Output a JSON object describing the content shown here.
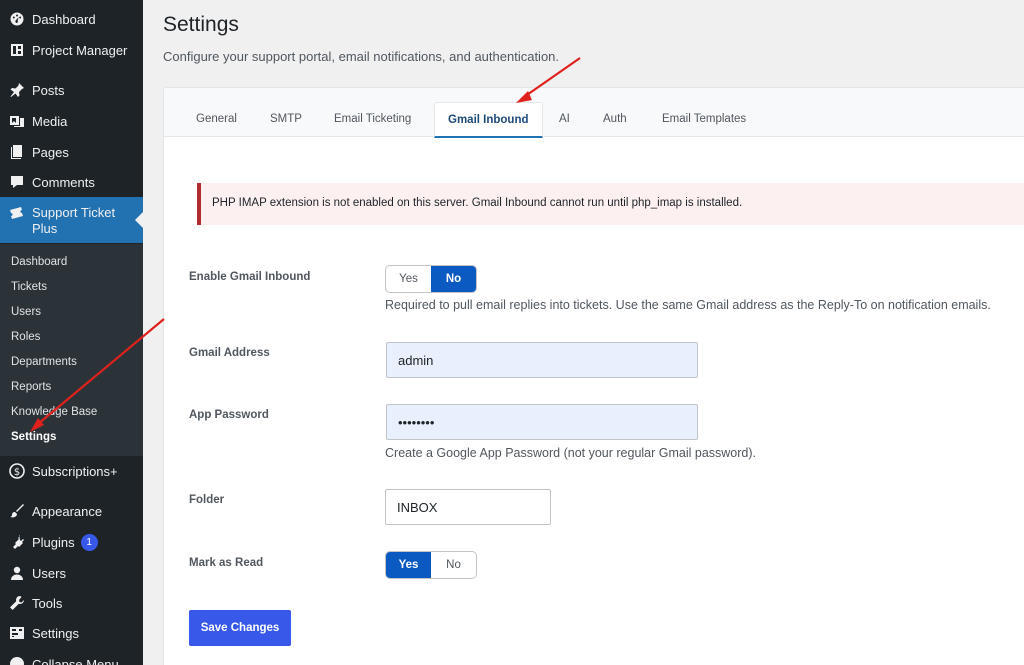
{
  "sidebar": {
    "items": [
      {
        "label": "Dashboard",
        "icon": "dashboard-icon"
      },
      {
        "label": "Project Manager",
        "icon": "project-icon"
      },
      {
        "label": "Posts",
        "icon": "pin-icon"
      },
      {
        "label": "Media",
        "icon": "media-icon"
      },
      {
        "label": "Pages",
        "icon": "pages-icon"
      },
      {
        "label": "Comments",
        "icon": "comment-icon"
      },
      {
        "label": "Support Ticket Plus",
        "icon": "ticket-icon"
      },
      {
        "label": "Subscriptions+",
        "icon": "dollar-icon"
      },
      {
        "label": "Appearance",
        "icon": "brush-icon"
      },
      {
        "label": "Plugins",
        "icon": "plug-icon",
        "badge": "1"
      },
      {
        "label": "Users",
        "icon": "user-icon"
      },
      {
        "label": "Tools",
        "icon": "wrench-icon"
      },
      {
        "label": "Settings",
        "icon": "settings-icon"
      },
      {
        "label": "Collapse Menu",
        "icon": "collapse-icon"
      }
    ],
    "submenu": [
      "Dashboard",
      "Tickets",
      "Users",
      "Roles",
      "Departments",
      "Reports",
      "Knowledge Base",
      "Settings"
    ]
  },
  "header": {
    "title": "Settings",
    "subtitle": "Configure your support portal, email notifications, and authentication."
  },
  "tabs": [
    "General",
    "SMTP",
    "Email Ticketing",
    "Gmail Inbound",
    "AI",
    "Auth",
    "Email Templates"
  ],
  "notice": "PHP IMAP extension is not enabled on this server. Gmail Inbound cannot run until php_imap is installed.",
  "form": {
    "enable": {
      "label": "Enable Gmail Inbound",
      "yes": "Yes",
      "no": "No",
      "help": "Required to pull email replies into tickets. Use the same Gmail address as the Reply-To on notification emails."
    },
    "gmail": {
      "label": "Gmail Address",
      "value": "admin"
    },
    "password": {
      "label": "App Password",
      "value": "password",
      "help": "Create a Google App Password (not your regular Gmail password)."
    },
    "folder": {
      "label": "Folder",
      "value": "INBOX"
    },
    "mark_read": {
      "label": "Mark as Read",
      "yes": "Yes",
      "no": "No"
    },
    "save": "Save Changes"
  },
  "colors": {
    "accent": "#2271b1",
    "toggle_on": "#0a5ac2",
    "save": "#3858e9",
    "error": "#b32d2e",
    "annotation": "#e0201b"
  }
}
